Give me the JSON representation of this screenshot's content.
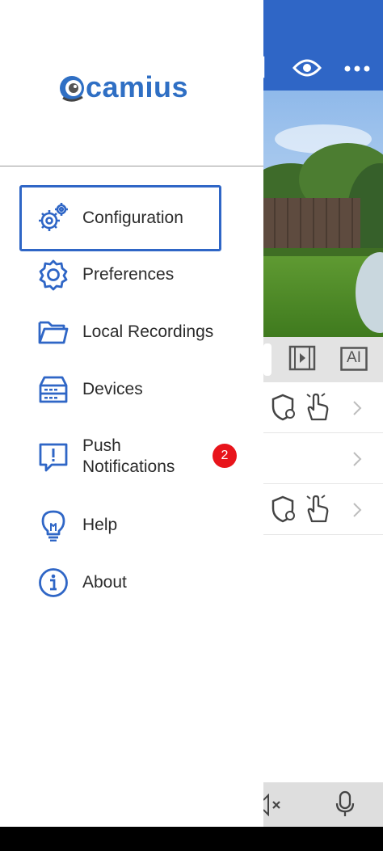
{
  "brand": {
    "logo_text": "camius"
  },
  "menu": [
    {
      "id": "configuration",
      "label": "Configuration",
      "icon": "gears-icon",
      "selected": true
    },
    {
      "id": "preferences",
      "label": "Preferences",
      "icon": "gear-icon"
    },
    {
      "id": "local-recordings",
      "label": "Local Recordings",
      "icon": "folder-icon"
    },
    {
      "id": "devices",
      "label": "Devices",
      "icon": "nvr-device-icon"
    },
    {
      "id": "push-notifications",
      "label_line1": "Push",
      "label_line2": "Notifications",
      "icon": "push-notification-icon",
      "badge": "2"
    },
    {
      "id": "help",
      "label": "Help",
      "icon": "lightbulb-icon"
    },
    {
      "id": "about",
      "label": "About",
      "icon": "info-icon"
    }
  ],
  "background": {
    "toolbar_ai_label": "AI",
    "header_icons": [
      "fullscreen-icon",
      "eye-icon",
      "more-dots-icon"
    ],
    "row_icons": [
      "shield-gear-icon",
      "touch-hand-icon",
      "chevron-right-icon"
    ],
    "bottom_icons": [
      "mute-icon",
      "microphone-icon"
    ]
  },
  "colors": {
    "accent": "#2f66c6",
    "badge": "#e8141b",
    "text": "#2b2b2b"
  }
}
